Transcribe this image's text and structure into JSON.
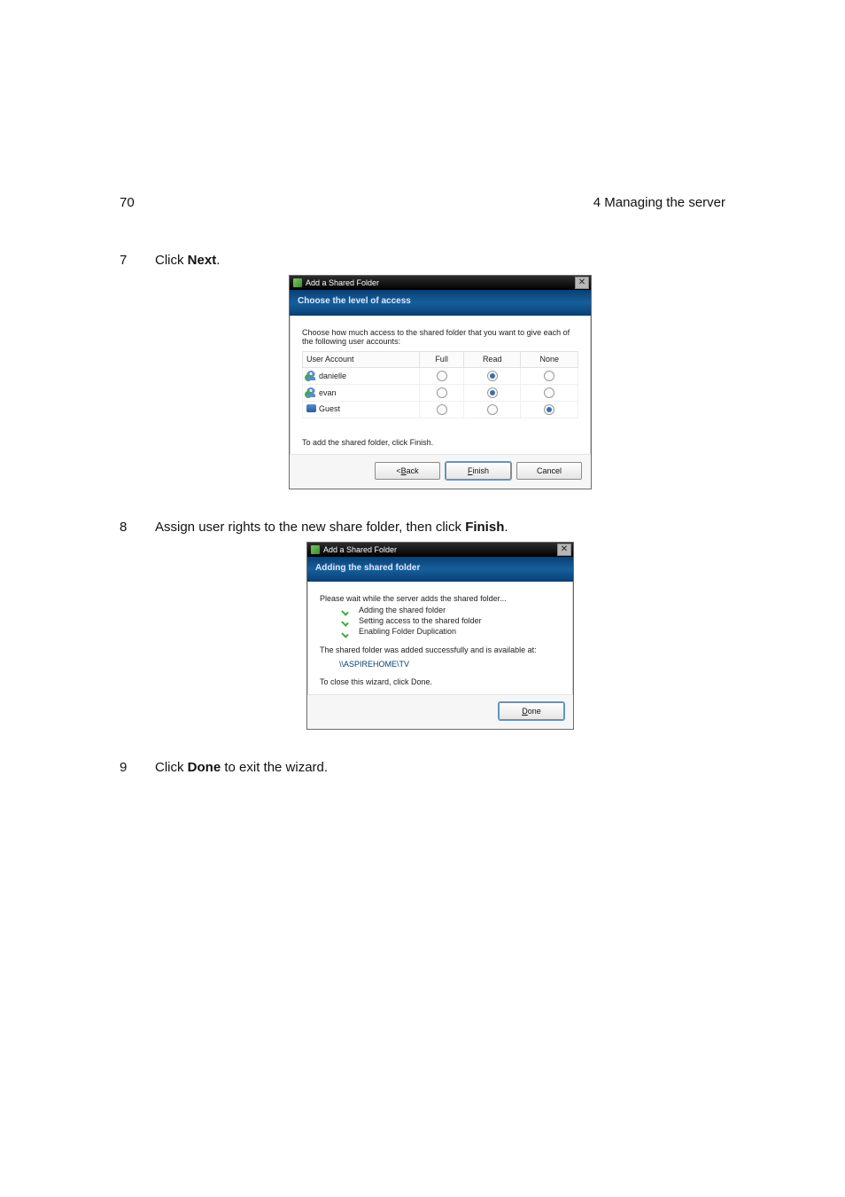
{
  "page": {
    "number": "70",
    "chapter": "4 Managing the server"
  },
  "steps": {
    "seven": {
      "num": "7",
      "prefix": "Click ",
      "bold": "Next",
      "suffix": "."
    },
    "eight": {
      "num": "8",
      "prefix": "Assign user rights to the new share folder, then click ",
      "bold": "Finish",
      "suffix": "."
    },
    "nine": {
      "num": "9",
      "prefix": "Click ",
      "bold": "Done",
      "suffix": " to exit the wizard."
    }
  },
  "dlg1": {
    "title": "Add a Shared Folder",
    "banner": "Choose the level of access",
    "instruction": "Choose how much access to the shared folder that you want to give each of the following user accounts:",
    "columns": {
      "user": "User Account",
      "full": "Full",
      "read": "Read",
      "none": "None"
    },
    "rows": [
      {
        "name": "danielle",
        "iconTick": true,
        "full": false,
        "read": true,
        "none": false
      },
      {
        "name": "evan",
        "iconTick": true,
        "full": false,
        "read": true,
        "none": false
      },
      {
        "name": "Guest",
        "iconTick": false,
        "full": false,
        "read": false,
        "none": true
      }
    ],
    "hint": "To add the shared folder, click Finish.",
    "buttons": {
      "back_lt": "< ",
      "back_u": "B",
      "back_rest": "ack",
      "finish_u": "F",
      "finish_rest": "inish",
      "cancel": "Cancel"
    }
  },
  "dlg2": {
    "title": "Add a Shared Folder",
    "banner": "Adding the shared folder",
    "instruction": "Please wait while the server adds the shared folder...",
    "items": [
      "Adding the shared folder",
      "Setting access to the shared folder",
      "Enabling Folder Duplication"
    ],
    "success": "The shared folder was added successfully and is available at:",
    "path": "\\\\ASPIREHOME\\TV",
    "closeHint": "To close this wizard, click Done.",
    "done_u": "D",
    "done_rest": "one"
  }
}
